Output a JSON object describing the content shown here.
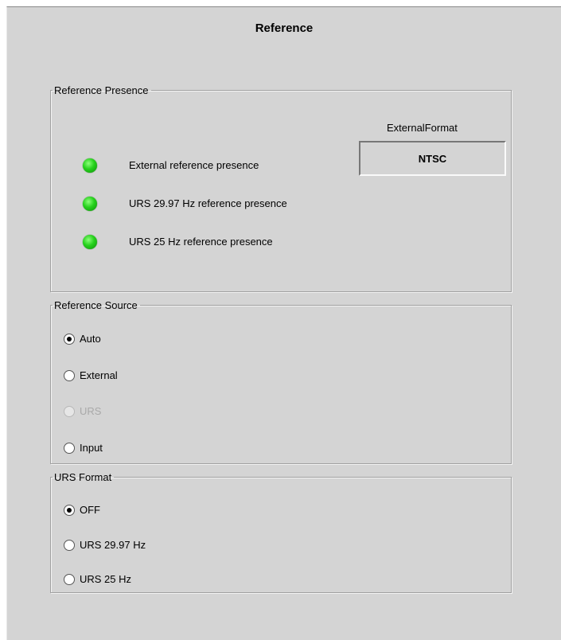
{
  "panel": {
    "title": "Reference"
  },
  "reference_presence": {
    "legend": "Reference Presence",
    "external_format_label": "ExternalFormat",
    "external_format_value": "NTSC",
    "indicators": [
      {
        "label": "External reference presence",
        "status": "green"
      },
      {
        "label": "URS 29.97 Hz reference presence",
        "status": "green"
      },
      {
        "label": "URS 25 Hz reference presence",
        "status": "green"
      }
    ]
  },
  "reference_source": {
    "legend": "Reference Source",
    "options": [
      {
        "label": "Auto",
        "selected": true,
        "enabled": true
      },
      {
        "label": "External",
        "selected": false,
        "enabled": true
      },
      {
        "label": "URS",
        "selected": false,
        "enabled": false
      },
      {
        "label": "Input",
        "selected": false,
        "enabled": true
      }
    ]
  },
  "urs_format": {
    "legend": "URS Format",
    "options": [
      {
        "label": "OFF",
        "selected": true,
        "enabled": true
      },
      {
        "label": "URS 29.97 Hz",
        "selected": false,
        "enabled": true
      },
      {
        "label": "URS 25 Hz",
        "selected": false,
        "enabled": true
      }
    ]
  },
  "colors": {
    "panel_bg": "#d4d4d4",
    "led_green": "#26d11c",
    "disabled_text": "#a9a9a9"
  }
}
